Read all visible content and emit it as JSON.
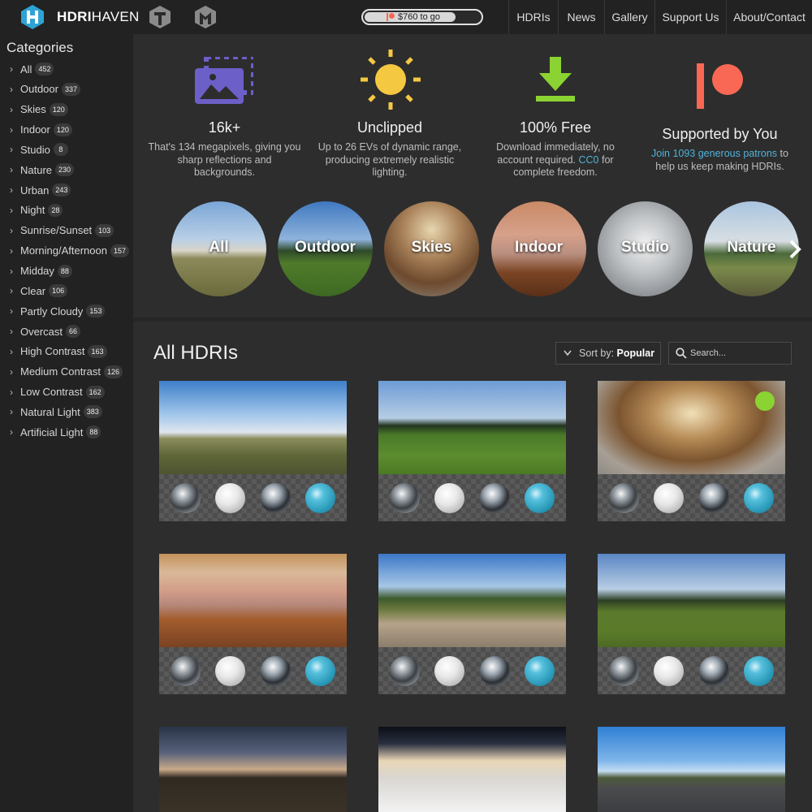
{
  "header": {
    "brand_bold": "HDRI",
    "brand_light": "HAVEN",
    "goal": {
      "text": "$760 to go",
      "progress_percent": 79
    },
    "nav": [
      "HDRIs",
      "News",
      "Gallery",
      "Support Us",
      "About/Contact"
    ]
  },
  "sidebar": {
    "title": "Categories",
    "items": [
      {
        "label": "All",
        "count": "452"
      },
      {
        "label": "Outdoor",
        "count": "337"
      },
      {
        "label": "Skies",
        "count": "120"
      },
      {
        "label": "Indoor",
        "count": "120"
      },
      {
        "label": "Studio",
        "count": "8"
      },
      {
        "label": "Nature",
        "count": "230"
      },
      {
        "label": "Urban",
        "count": "243"
      },
      {
        "label": "Night",
        "count": "28"
      },
      {
        "label": "Sunrise/Sunset",
        "count": "103"
      },
      {
        "label": "Morning/Afternoon",
        "count": "157"
      },
      {
        "label": "Midday",
        "count": "88"
      },
      {
        "label": "Clear",
        "count": "106"
      },
      {
        "label": "Partly Cloudy",
        "count": "153"
      },
      {
        "label": "Overcast",
        "count": "66"
      },
      {
        "label": "High Contrast",
        "count": "163"
      },
      {
        "label": "Medium Contrast",
        "count": "126"
      },
      {
        "label": "Low Contrast",
        "count": "162"
      },
      {
        "label": "Natural Light",
        "count": "383"
      },
      {
        "label": "Artificial Light",
        "count": "88"
      }
    ]
  },
  "features": [
    {
      "icon": "image-icon",
      "title": "16k+",
      "desc": "That's 134 megapixels, giving you sharp reflections and backgrounds."
    },
    {
      "icon": "sun-icon",
      "title": "Unclipped",
      "desc": "Up to 26 EVs of dynamic range, producing extremely realistic lighting."
    },
    {
      "icon": "download-icon",
      "title": "100% Free",
      "desc_a": "Download immediately, no account required. ",
      "link": "CC0",
      "desc_b": " for complete freedom."
    },
    {
      "icon": "patreon-icon",
      "title": "Supported by You",
      "link": "Join 1093 generous patrons",
      "desc_b": " to help us keep making HDRIs."
    }
  ],
  "category_circles": [
    "All",
    "Outdoor",
    "Skies",
    "Indoor",
    "Studio",
    "Nature"
  ],
  "main": {
    "title": "All HDRIs",
    "sort_prefix": "Sort by: ",
    "sort_value": "Popular",
    "search_placeholder": "Search..."
  },
  "colors": {
    "accent_link": "#4fb3d9",
    "image_icon": "#6c5fc7",
    "sun_icon": "#f5c842",
    "download_icon": "#8bd332",
    "patreon_icon": "#f96854",
    "new_badge": "#8bd332"
  }
}
